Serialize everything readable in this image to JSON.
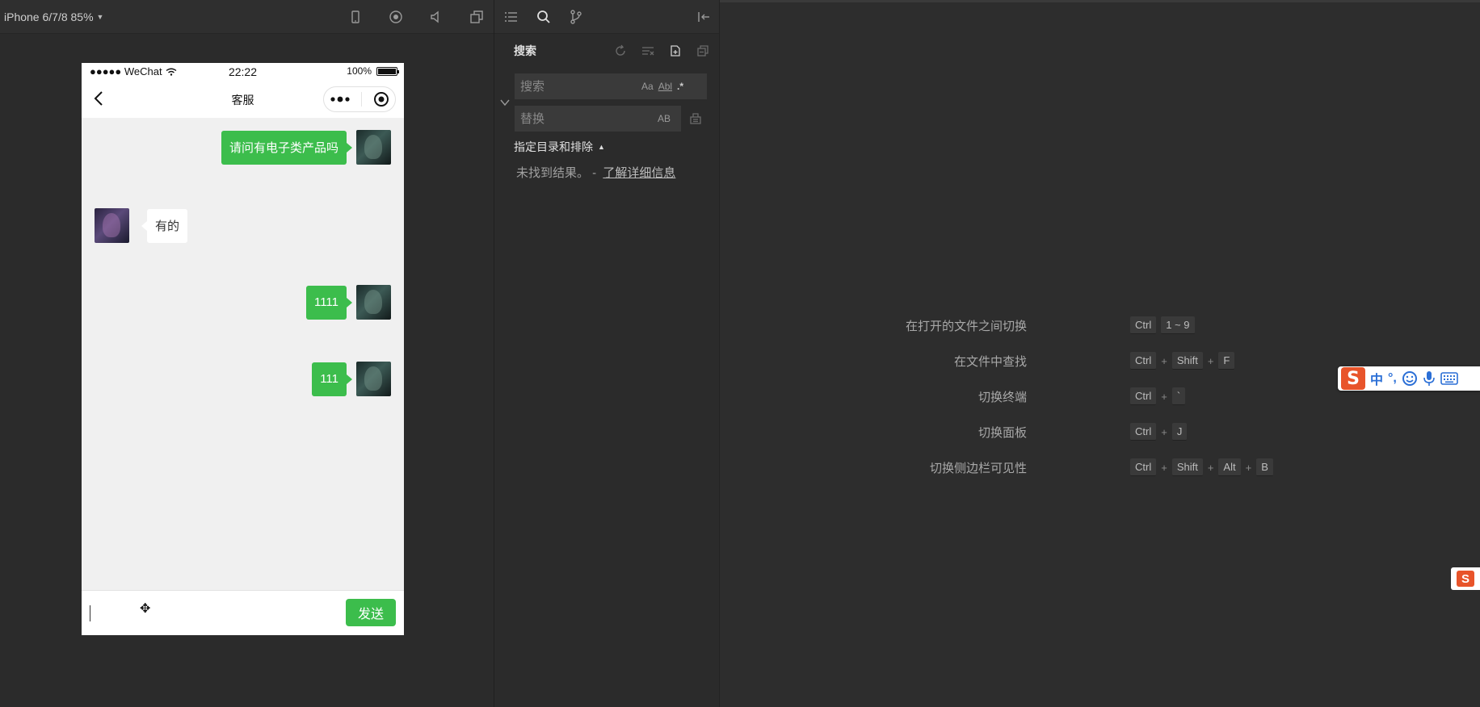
{
  "simulator": {
    "device_label": "iPhone 6/7/8 85%",
    "status_bar": {
      "carrier": "●●●●● WeChat",
      "time": "22:22",
      "battery": "100%"
    },
    "nav": {
      "title": "客服"
    },
    "messages": [
      {
        "side": "right",
        "text": "请问有电子类产品吗"
      },
      {
        "side": "left",
        "text": "有的"
      },
      {
        "side": "right",
        "text": "1111"
      },
      {
        "side": "right",
        "text": "111"
      }
    ],
    "input": {
      "value": "",
      "placeholder": ""
    },
    "send_label": "发送"
  },
  "search_panel": {
    "title": "搜索",
    "search_placeholder": "搜索",
    "replace_placeholder": "替换",
    "opt_case": "Aa",
    "opt_word": "Abl",
    "opt_regex": ".*",
    "opt_preserve": "AB",
    "include_exclude_label": "指定目录和排除",
    "no_result_text": "未找到结果。 -",
    "learn_more_link": "了解详细信息"
  },
  "editor": {
    "shortcuts": [
      {
        "label": "在打开的文件之间切换",
        "keys": [
          "Ctrl",
          "1 ~ 9"
        ],
        "sep": [
          ""
        ]
      },
      {
        "label": "在文件中查找",
        "keys": [
          "Ctrl",
          "Shift",
          "F"
        ],
        "sep": [
          "+",
          "+"
        ]
      },
      {
        "label": "切换终端",
        "keys": [
          "Ctrl",
          "`"
        ],
        "sep": [
          "+"
        ]
      },
      {
        "label": "切换面板",
        "keys": [
          "Ctrl",
          "J"
        ],
        "sep": [
          "+"
        ]
      },
      {
        "label": "切换侧边栏可见性",
        "keys": [
          "Ctrl",
          "Shift",
          "Alt",
          "B"
        ],
        "sep": [
          "+",
          "+",
          "+"
        ]
      }
    ]
  },
  "ime": {
    "logo": "S",
    "mode": "中",
    "punct": "°,",
    "emoji_icon": "smile-icon",
    "mic_icon": "mic-icon",
    "keyboard_icon": "keyboard-icon"
  },
  "colors": {
    "accent_green": "#3cbd4c",
    "ime_orange": "#e8542a",
    "ime_blue": "#2b6fd6"
  }
}
